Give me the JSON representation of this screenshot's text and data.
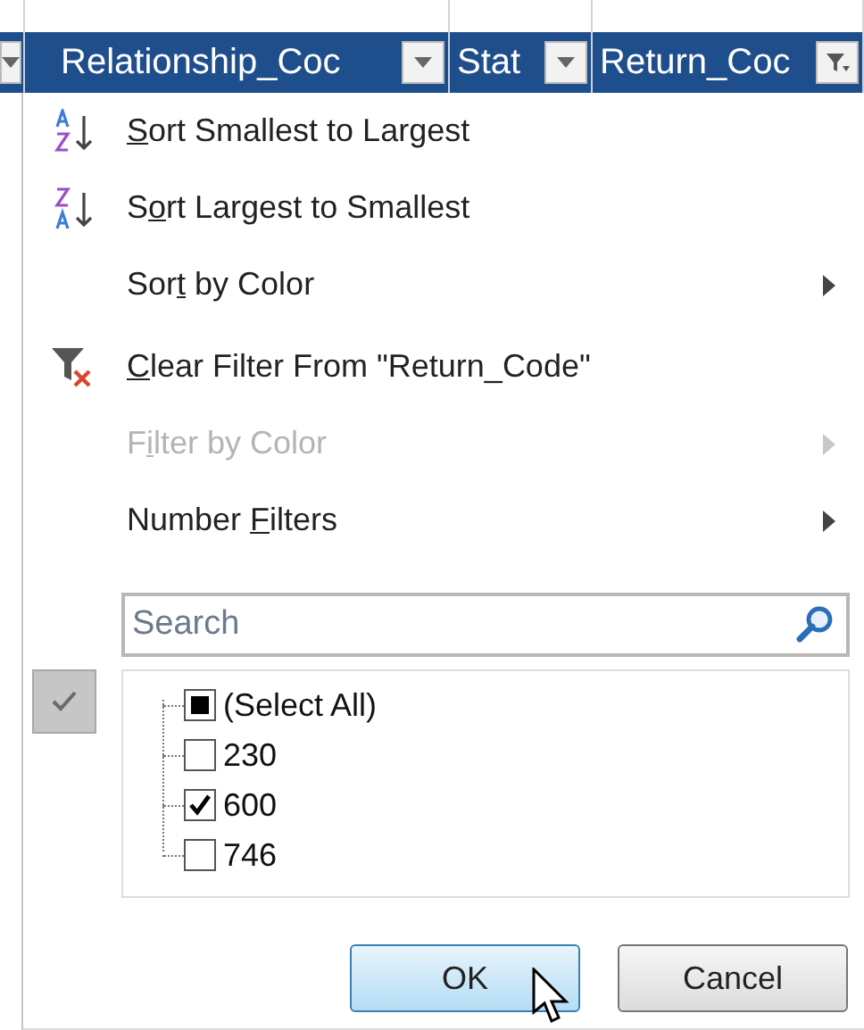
{
  "header": {
    "columns": [
      {
        "filtered": false
      },
      {
        "label": "Relationship_Coc",
        "filtered": false
      },
      {
        "label": "Stat",
        "filtered": false
      },
      {
        "label": "Return_Coc",
        "filtered": true
      }
    ]
  },
  "menu": {
    "groups": [
      [
        {
          "kind": "sort-asc",
          "key": "S",
          "after": "ort Smallest to Largest",
          "disabled": false,
          "submenu": false
        },
        {
          "kind": "sort-desc",
          "before": "S",
          "key": "o",
          "after": "rt Largest to Smallest",
          "disabled": false,
          "submenu": false
        },
        {
          "kind": "plain",
          "before": "Sor",
          "key": "t",
          "after": " by Color",
          "disabled": false,
          "submenu": true
        }
      ],
      [
        {
          "kind": "clear-filter",
          "key": "C",
          "after": "lear Filter From \"Return_Code\"",
          "disabled": false,
          "submenu": false
        },
        {
          "kind": "plain",
          "before": "F",
          "key": "i",
          "after": "lter by Color",
          "disabled": true,
          "submenu": true
        },
        {
          "kind": "plain",
          "before": "Number ",
          "key": "F",
          "after": "ilters",
          "disabled": false,
          "submenu": true
        }
      ]
    ]
  },
  "search": {
    "placeholder": "Search"
  },
  "values": [
    {
      "label": "(Select All)",
      "checked": false,
      "indeterminate": true
    },
    {
      "label": "230",
      "checked": false,
      "indeterminate": false
    },
    {
      "label": "600",
      "checked": true,
      "indeterminate": false
    },
    {
      "label": "746",
      "checked": false,
      "indeterminate": false
    }
  ],
  "buttons": [
    {
      "label": "OK",
      "selected": true
    },
    {
      "label": "Cancel",
      "selected": false
    }
  ]
}
